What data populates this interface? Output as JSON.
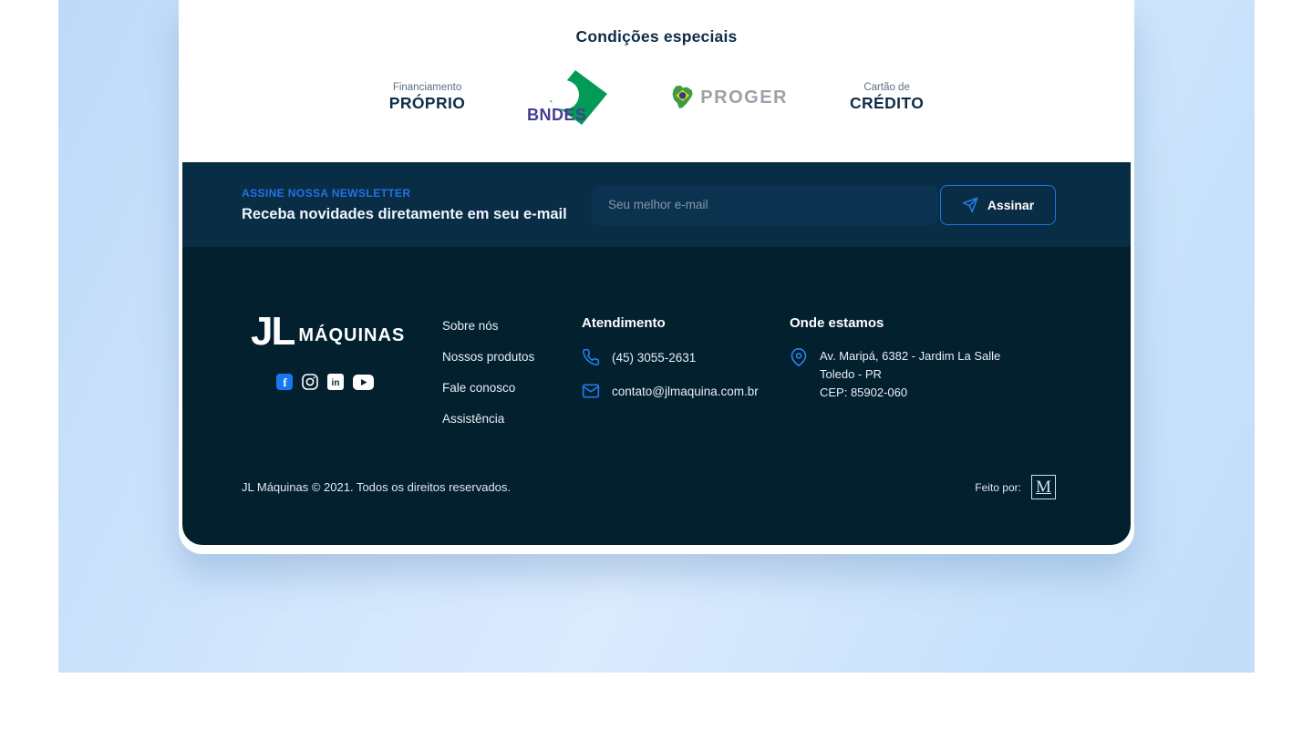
{
  "conditions": {
    "title": "Condições especiais",
    "financing": {
      "label_top": "Financiamento",
      "label_bottom": "PRÓPRIO"
    },
    "bndes_label": "BNDES",
    "proger_label": "PROGER",
    "credit": {
      "label_top": "Cartão de",
      "label_bottom": "CRÉDITO"
    }
  },
  "newsletter": {
    "eyebrow": "ASSINE NOSSA NEWSLETTER",
    "title": "Receba novidades diretamente em seu e-mail",
    "input_placeholder": "Seu melhor e-mail",
    "button_label": "Assinar"
  },
  "footer": {
    "brand": {
      "monogram": "JL",
      "name": "MÁQUINAS"
    },
    "social": [
      "facebook",
      "instagram",
      "linkedin",
      "youtube"
    ],
    "links": [
      "Sobre nós",
      "Nossos produtos",
      "Fale conosco",
      "Assistência"
    ],
    "support": {
      "title": "Atendimento",
      "phone": "(45) 3055-2631",
      "email": "contato@jlmaquina.com.br"
    },
    "location": {
      "title": "Onde estamos",
      "line1": "Av. Maripá, 6382 - Jardim La Salle",
      "line2": "Toledo - PR",
      "line3": "CEP: 85902-060"
    },
    "copyright": "JL Máquinas © 2021. Todos os direitos reservados.",
    "made_by_label": "Feito por:",
    "made_by_monogram": "M"
  },
  "icons": {
    "send": "send-icon",
    "phone": "phone-icon",
    "email": "mail-icon",
    "pin": "map-pin-icon",
    "social": [
      "facebook-icon",
      "instagram-icon",
      "linkedin-icon",
      "youtube-icon"
    ]
  },
  "colors": {
    "accent_blue": "#2173E6",
    "newsletter_band": "#0A2D46",
    "footer_bg": "#03202F",
    "backdrop_blue": "#CCE3FB",
    "heading_navy": "#0E2D49",
    "facebook_blue": "#1877F2",
    "bndes_green": "#019B57",
    "bndes_purple": "#443E8F",
    "proger_gray": "#9AA1A8",
    "brazil_green": "#3E9B45"
  }
}
